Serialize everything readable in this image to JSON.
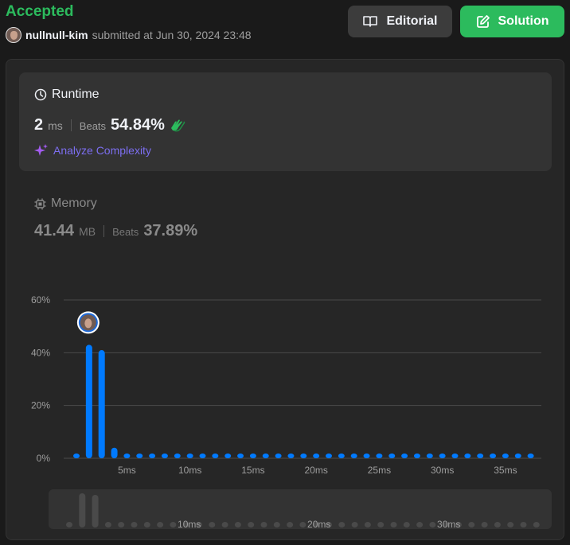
{
  "header": {
    "status": "Accepted",
    "username": "nullnull-kim",
    "submitted_text": "submitted at Jun 30, 2024 23:48",
    "editorial_label": "Editorial",
    "solution_label": "Solution"
  },
  "runtime": {
    "title": "Runtime",
    "value": "2",
    "unit": "ms",
    "beats_label": "Beats",
    "beats_value": "54.84%",
    "analyze_label": "Analyze Complexity"
  },
  "memory": {
    "title": "Memory",
    "value": "41.44",
    "unit": "MB",
    "beats_label": "Beats",
    "beats_value": "37.89%"
  },
  "colors": {
    "accepted": "#2cbb5d",
    "bar": "#007aff",
    "analyze": "#7c6ef0"
  },
  "chart_data": {
    "type": "bar",
    "x": [
      1,
      2,
      3,
      4,
      5,
      6,
      7,
      8,
      9,
      10,
      11,
      12,
      13,
      14,
      15,
      16,
      17,
      18,
      19,
      20,
      21,
      22,
      23,
      24,
      25,
      26,
      27,
      28,
      29,
      30,
      31,
      32,
      33,
      34,
      35,
      36,
      37
    ],
    "values": [
      0.5,
      43,
      41,
      4,
      0.5,
      0.5,
      0.5,
      0.5,
      0.5,
      0.5,
      0.5,
      0.5,
      0.5,
      0.5,
      0.5,
      0.5,
      0.5,
      0.5,
      0.5,
      0.5,
      0.5,
      0.5,
      0.5,
      0.5,
      0.5,
      0.5,
      0.5,
      0.5,
      0.5,
      0.5,
      0.5,
      0.5,
      0.5,
      0.5,
      0.5,
      0.5,
      0.5
    ],
    "y_ticks": [
      "0%",
      "20%",
      "40%",
      "60%"
    ],
    "x_tick_labels": [
      {
        "x": 5,
        "label": "5ms"
      },
      {
        "x": 10,
        "label": "10ms"
      },
      {
        "x": 15,
        "label": "15ms"
      },
      {
        "x": 20,
        "label": "20ms"
      },
      {
        "x": 25,
        "label": "25ms"
      },
      {
        "x": 30,
        "label": "30ms"
      },
      {
        "x": 35,
        "label": "35ms"
      }
    ],
    "ylim": [
      0,
      60
    ],
    "highlight_x": 2,
    "brush_values": [
      0.5,
      43,
      41,
      4,
      0.5,
      0.5,
      0.5,
      0.5,
      0.5,
      0.5,
      0.5,
      0.5,
      0.5,
      0.5,
      0.5,
      0.5,
      0.5,
      0.5,
      0.5,
      0.5,
      0.5,
      0.5,
      0.5,
      0.5,
      0.5,
      0.5,
      0.5,
      0.5,
      0.5,
      0.5,
      0.5,
      0.5,
      0.5,
      0.5,
      0.5,
      0.5,
      0.5
    ],
    "brush_labels": [
      {
        "x": 10,
        "label": "10ms"
      },
      {
        "x": 20,
        "label": "20ms"
      },
      {
        "x": 30,
        "label": "30ms"
      }
    ]
  }
}
